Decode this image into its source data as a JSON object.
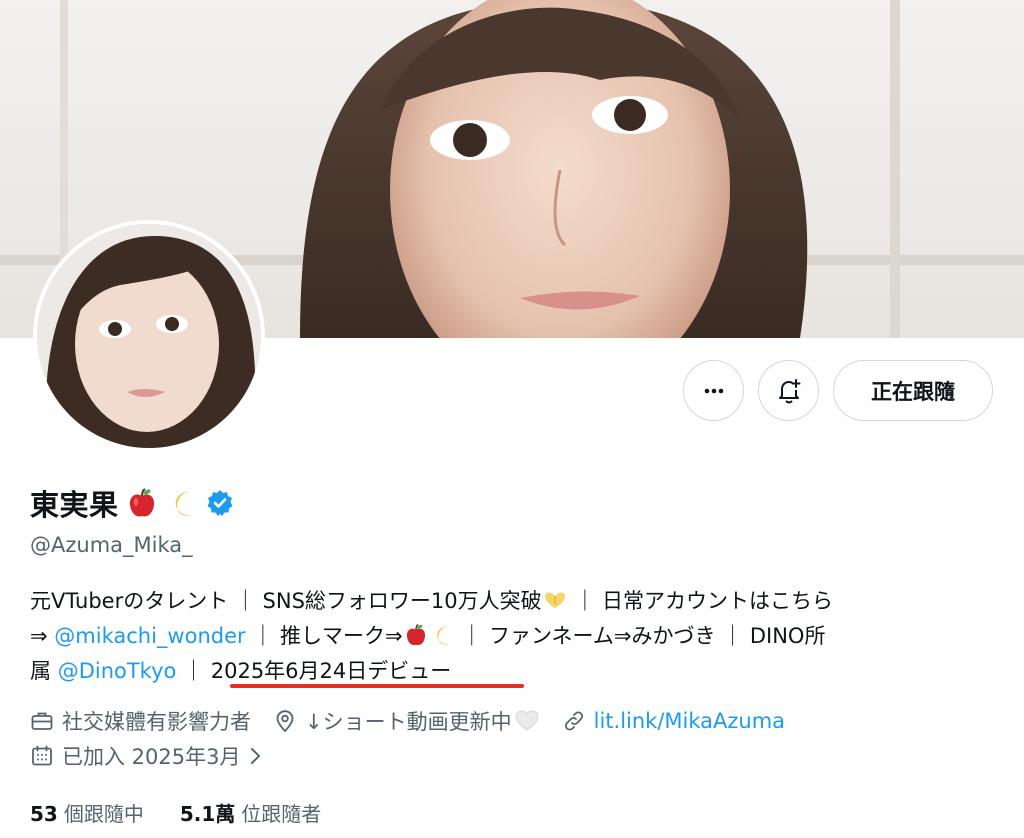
{
  "profile": {
    "display_name": "東実果",
    "handle": "@Azuma_Mika_",
    "verified_icon": "verified-badge-icon",
    "name_emojis": [
      "apple-emoji",
      "crescent-moon-emoji"
    ]
  },
  "actions": {
    "more_icon": "more-icon",
    "subscribe_icon": "bell-plus-icon",
    "following_label": "正在跟隨"
  },
  "bio": {
    "line1": "元VTuberのタレント ｜ SNS総フォロワー10万人突破",
    "line1_tail": " ｜ 日常アカウントはこちら",
    "line2_prefix": "⇒ ",
    "mention1": "@mikachi_wonder",
    "line2_mid": " ｜ 推しマーク⇒",
    "line2_tail": " ｜ ファンネーム⇒みかづき ｜ DINO所",
    "line3_prefix": "属 ",
    "mention2": "@DinoTkyo",
    "line3_sep": " ｜ ",
    "debut": "2025年6月24日デビュー"
  },
  "meta": {
    "category": "社交媒體有影響力者",
    "location": "↓ショート動画更新中",
    "website": "lit.link/MikaAzuma",
    "joined": "已加入 2025年3月"
  },
  "counts": {
    "following_value": "53",
    "following_label": "個跟隨中",
    "followers_value": "5.1萬",
    "followers_label": "位跟隨者"
  },
  "colors": {
    "link": "#1d9bf0",
    "secondary_text": "#536471",
    "underline": "#e0321c",
    "verified": "#1d9bf0"
  }
}
